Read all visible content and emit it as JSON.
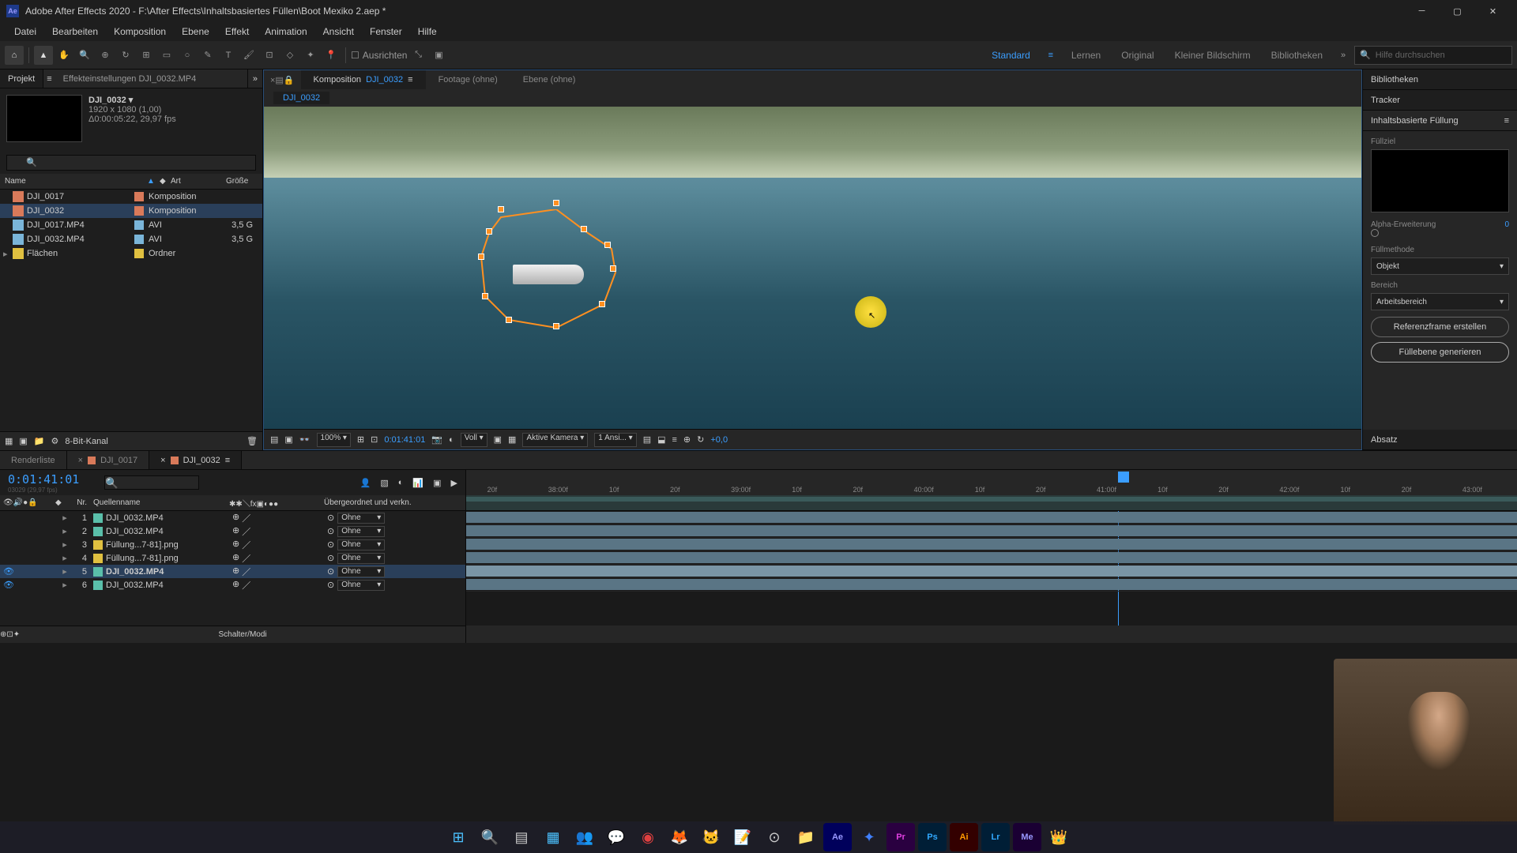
{
  "window": {
    "title": "Adobe After Effects 2020 - F:\\After Effects\\Inhaltsbasiertes Füllen\\Boot Mexiko 2.aep *"
  },
  "menu": [
    "Datei",
    "Bearbeiten",
    "Komposition",
    "Ebene",
    "Effekt",
    "Animation",
    "Ansicht",
    "Fenster",
    "Hilfe"
  ],
  "toolbar": {
    "align_label": "Ausrichten",
    "workspaces": [
      "Standard",
      "Lernen",
      "Original",
      "Kleiner Bildschirm",
      "Bibliotheken"
    ],
    "active_workspace": "Standard",
    "search_placeholder": "Hilfe durchsuchen"
  },
  "project": {
    "panel_tab": "Projekt",
    "effect_settings_tab": "Effekteinstellungen DJI_0032.MP4",
    "selected_name": "DJI_0032",
    "selected_info1": "1920 x 1080 (1,00)",
    "selected_info2": "Δ0:00:05:22, 29,97 fps",
    "columns": {
      "name": "Name",
      "art": "Art",
      "size": "Größe"
    },
    "items": [
      {
        "name": "DJI_0017",
        "art": "Komposition",
        "size": "",
        "label": "#d97a5a",
        "icon": "comp",
        "selected": false
      },
      {
        "name": "DJI_0032",
        "art": "Komposition",
        "size": "",
        "label": "#d97a5a",
        "icon": "comp",
        "selected": true
      },
      {
        "name": "DJI_0017.MP4",
        "art": "AVI",
        "size": "3,5 G",
        "label": "#7ab5d9",
        "icon": "footage",
        "selected": false
      },
      {
        "name": "DJI_0032.MP4",
        "art": "AVI",
        "size": "3,5 G",
        "label": "#7ab5d9",
        "icon": "footage",
        "selected": false
      },
      {
        "name": "Flächen",
        "art": "Ordner",
        "size": "",
        "label": "#e0c040",
        "icon": "folder",
        "selected": false
      }
    ],
    "footer_depth": "8-Bit-Kanal"
  },
  "comp": {
    "tab_prefix": "Komposition",
    "tab_name": "DJI_0032",
    "footage_tab": "Footage (ohne)",
    "layer_tab": "Ebene (ohne)",
    "breadcrumb": "DJI_0032",
    "footer": {
      "zoom": "100%",
      "time": "0:01:41:01",
      "res": "Voll",
      "camera": "Aktive Kamera",
      "views": "1 Ansi...",
      "exposure": "+0,0"
    }
  },
  "right": {
    "panels": [
      "Bibliotheken",
      "Tracker",
      "Inhaltsbasierte Füllung"
    ],
    "caf": {
      "fill_target": "Füllziel",
      "alpha_label": "Alpha-Erweiterung",
      "alpha_value": "0",
      "fill_method_label": "Füllmethode",
      "fill_method_value": "Objekt",
      "range_label": "Bereich",
      "range_value": "Arbeitsbereich",
      "ref_frame_btn": "Referenzframe erstellen",
      "generate_btn": "Füllebene generieren"
    },
    "absatz": "Absatz"
  },
  "timeline": {
    "tabs": [
      {
        "label": "Renderliste",
        "icon": ""
      },
      {
        "label": "DJI_0017",
        "icon": "comp"
      },
      {
        "label": "DJI_0032",
        "icon": "comp",
        "active": true
      }
    ],
    "time": "0:01:41:01",
    "time_sub": "03029 (29,97 fps)",
    "col_nr": "Nr.",
    "col_source": "Quellenname",
    "col_parent": "Übergeordnet und verkn.",
    "parent_none": "Ohne",
    "layers": [
      {
        "num": "1",
        "name": "DJI_0032.MP4",
        "label": "#5abfaa",
        "icon": "footage",
        "visible": false
      },
      {
        "num": "2",
        "name": "DJI_0032.MP4",
        "label": "#5abfaa",
        "icon": "footage",
        "visible": false
      },
      {
        "num": "3",
        "name": "Füllung...7-81].png",
        "label": "#e0c040",
        "icon": "image",
        "visible": false
      },
      {
        "num": "4",
        "name": "Füllung...7-81].png",
        "label": "#e0c040",
        "icon": "image",
        "visible": false
      },
      {
        "num": "5",
        "name": "DJI_0032.MP4",
        "label": "#5abfaa",
        "icon": "footage",
        "visible": true,
        "selected": true
      },
      {
        "num": "6",
        "name": "DJI_0032.MP4",
        "label": "#5abfaa",
        "icon": "footage",
        "visible": true
      }
    ],
    "footer": "Schalter/Modi",
    "ruler_ticks": [
      "20f",
      "38:00f",
      "10f",
      "20f",
      "39:00f",
      "10f",
      "20f",
      "40:00f",
      "10f",
      "20f",
      "41:00f",
      "10f",
      "20f",
      "42:00f",
      "10f",
      "20f",
      "43:00f"
    ]
  }
}
